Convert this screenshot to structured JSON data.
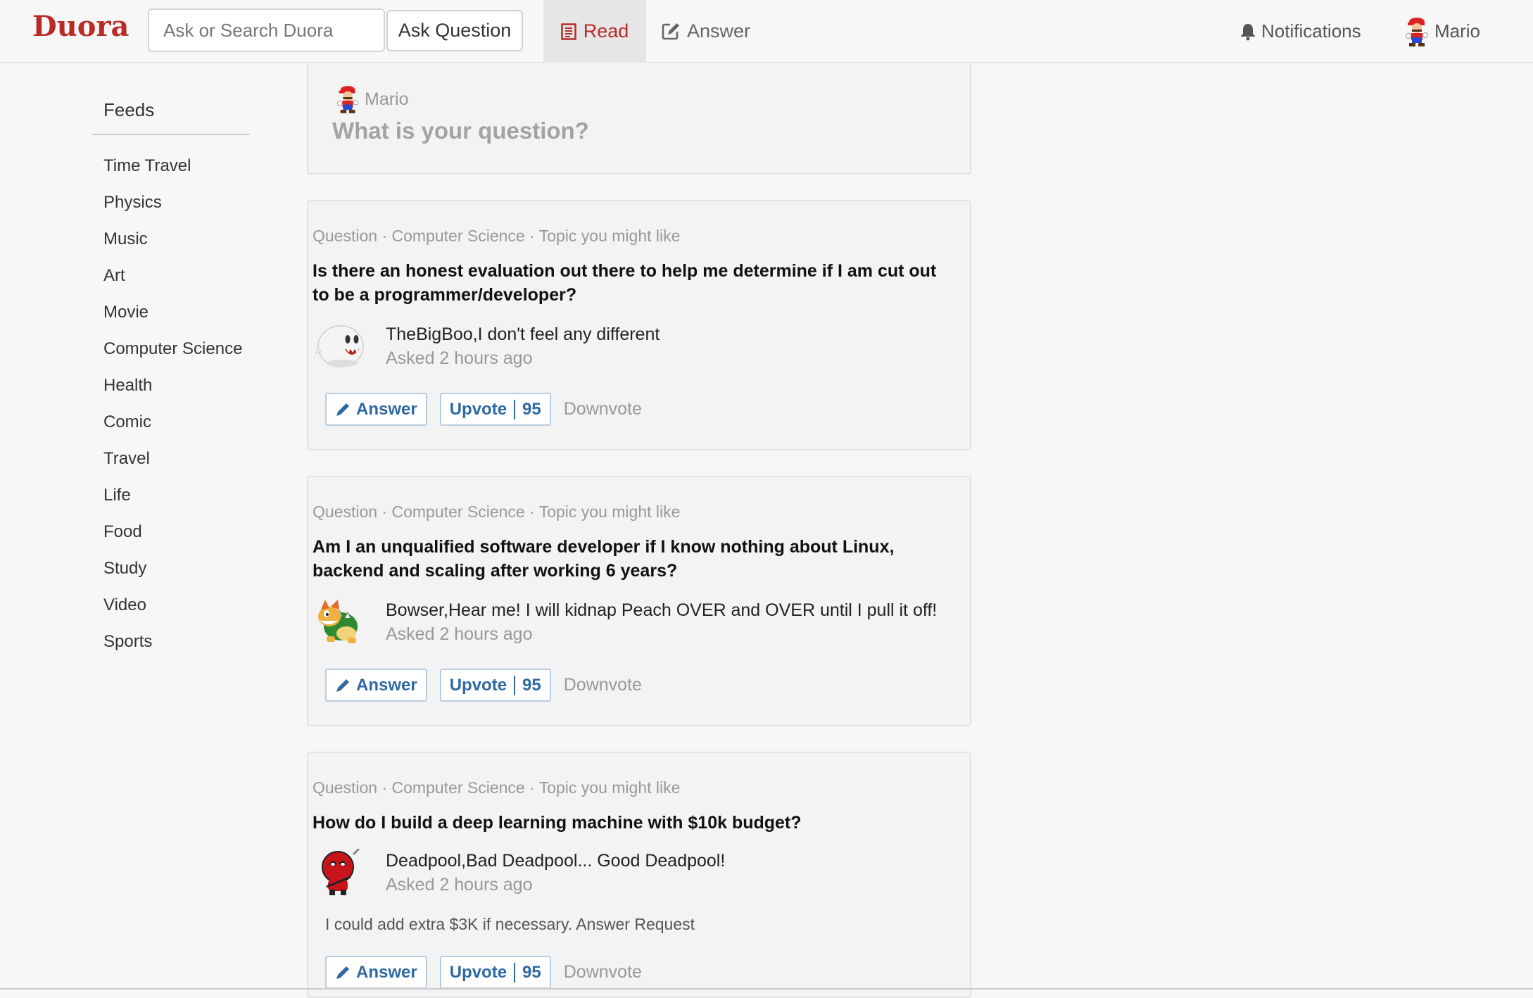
{
  "header": {
    "logo": "Duora",
    "search_placeholder": "Ask or Search Duora",
    "ask_button": "Ask Question",
    "nav_read": "Read",
    "nav_answer": "Answer",
    "notifications": "Notifications",
    "user_name": "Mario"
  },
  "sidebar": {
    "title": "Feeds",
    "items": [
      "Time Travel",
      "Physics",
      "Music",
      "Art",
      "Movie",
      "Computer Science",
      "Health",
      "Comic",
      "Travel",
      "Life",
      "Food",
      "Study",
      "Video",
      "Sports"
    ]
  },
  "ask_box": {
    "user": "Mario",
    "prompt": "What is your question?"
  },
  "questions": [
    {
      "meta": "Question · Computer Science · Topic you might like",
      "title": "Is there an honest evaluation out there to help me determine if I am cut out to be a programmer/developer?",
      "author": "TheBigBoo,",
      "tagline": "I don't feel any different",
      "asked": "Asked 2 hours ago",
      "answer_label": "Answer",
      "upvote_label": "Upvote",
      "upvote_count": "95",
      "downvote_label": "Downvote"
    },
    {
      "meta": "Question · Computer Science · Topic you might like",
      "title": "Am I an unqualified software developer if I know nothing about Linux, backend and scaling after working 6 years?",
      "author": "Bowser,",
      "tagline": "Hear me! I will kidnap Peach OVER and OVER until I pull it off!",
      "asked": "Asked 2 hours ago",
      "answer_label": "Answer",
      "upvote_label": "Upvote",
      "upvote_count": "95",
      "downvote_label": "Downvote"
    },
    {
      "meta": "Question · Computer Science · Topic you might like",
      "title": "How do I build a deep learning machine with $10k budget?",
      "author": "Deadpool,",
      "tagline": "Bad Deadpool... Good Deadpool!",
      "asked": "Asked 2 hours ago",
      "detail": "I could add extra $3K if necessary. Answer Request",
      "answer_label": "Answer",
      "upvote_label": "Upvote",
      "upvote_count": "95",
      "downvote_label": "Downvote"
    }
  ],
  "colors": {
    "brand": "#b92b27",
    "link_blue": "#2e69a3",
    "muted": "#999999"
  },
  "icons": [
    "read-icon",
    "answer-edit-icon",
    "bell-icon",
    "pencil-icon"
  ]
}
